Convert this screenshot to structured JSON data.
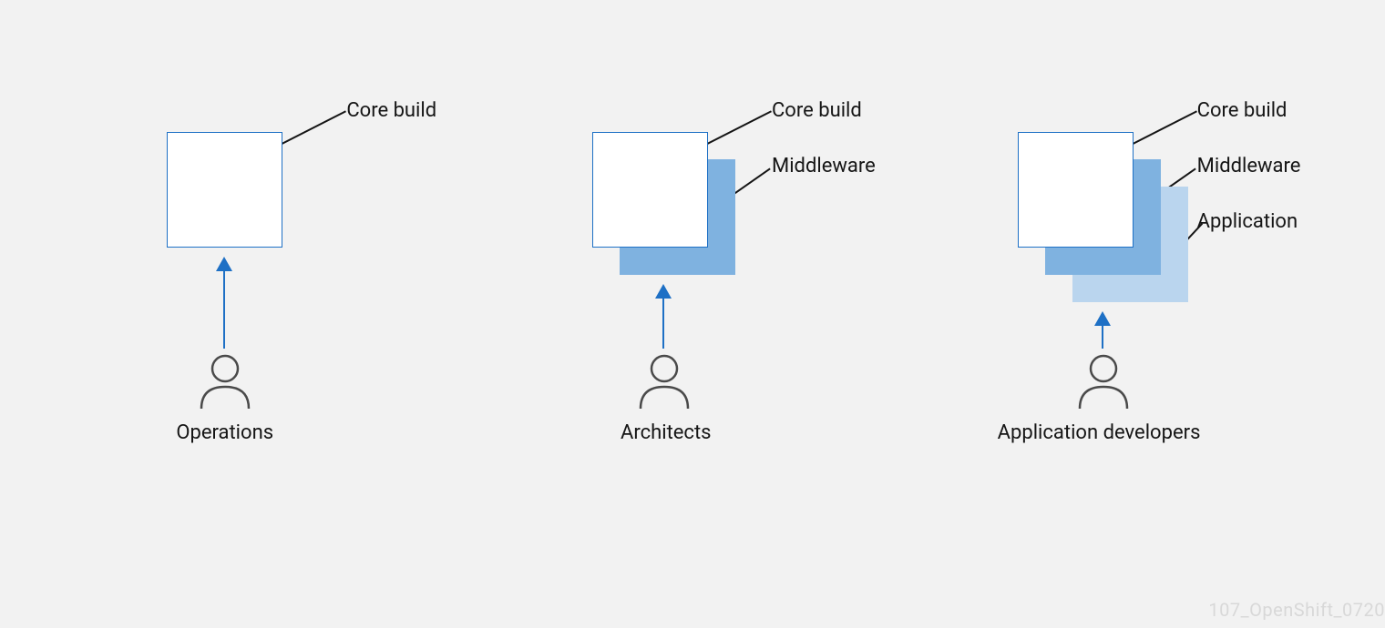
{
  "columns": [
    {
      "role": "Operations",
      "layers": [
        {
          "name": "Core build"
        }
      ]
    },
    {
      "role": "Architects",
      "layers": [
        {
          "name": "Core build"
        },
        {
          "name": "Middleware"
        }
      ]
    },
    {
      "role": "Application developers",
      "layers": [
        {
          "name": "Core build"
        },
        {
          "name": "Middleware"
        },
        {
          "name": "Application"
        }
      ]
    }
  ],
  "watermark": "107_OpenShift_0720"
}
